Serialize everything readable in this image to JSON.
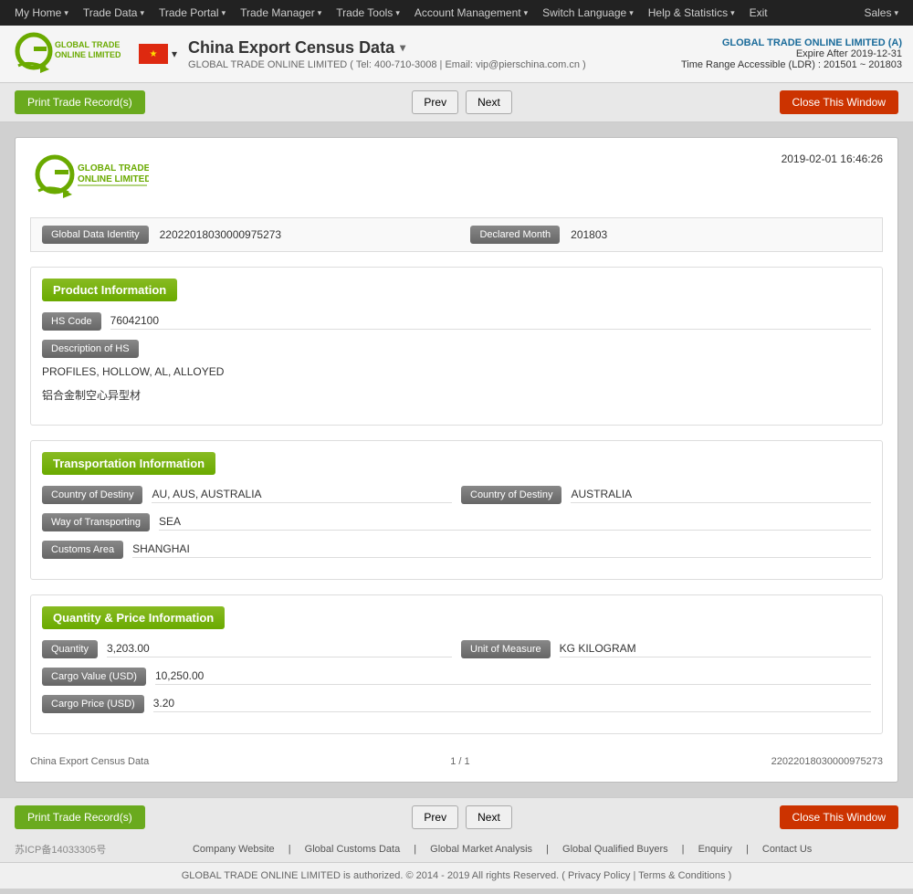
{
  "topNav": {
    "items": [
      {
        "label": "My Home",
        "hasArrow": true
      },
      {
        "label": "Trade Data",
        "hasArrow": true
      },
      {
        "label": "Trade Portal",
        "hasArrow": true
      },
      {
        "label": "Trade Manager",
        "hasArrow": true
      },
      {
        "label": "Trade Tools",
        "hasArrow": true
      },
      {
        "label": "Account Management",
        "hasArrow": true
      },
      {
        "label": "Switch Language",
        "hasArrow": true
      },
      {
        "label": "Help & Statistics",
        "hasArrow": true
      },
      {
        "label": "Exit",
        "hasArrow": false
      }
    ],
    "salesLabel": "Sales"
  },
  "header": {
    "title": "China Export Census Data",
    "subtitle": "GLOBAL TRADE ONLINE LIMITED ( Tel: 400-710-3008 | Email: vip@pierschina.com.cn )",
    "companyName": "GLOBAL TRADE ONLINE LIMITED (A)",
    "expire": "Expire After 2019-12-31",
    "ldr": "Time Range Accessible (LDR) : 201501 ~ 201803"
  },
  "actionBar": {
    "printLabel": "Print Trade Record(s)",
    "prevLabel": "Prev",
    "nextLabel": "Next",
    "closeLabel": "Close This Window"
  },
  "record": {
    "timestamp": "2019-02-01 16:46:26",
    "globalDataIdentityLabel": "Global Data Identity",
    "globalDataIdentityValue": "22022018030000975273",
    "declaredMonthLabel": "Declared Month",
    "declaredMonthValue": "201803",
    "productInfo": {
      "sectionLabel": "Product Information",
      "hsCodeLabel": "HS Code",
      "hsCodeValue": "76042100",
      "descriptionOfHSLabel": "Description of HS",
      "descriptionLine1": "PROFILES, HOLLOW, AL, ALLOYED",
      "descriptionLine2": "铝合金制空心异型材"
    },
    "transportInfo": {
      "sectionLabel": "Transportation Information",
      "countryOfDestinyLabel": "Country of Destiny",
      "countryOfDestinyValue": "AU, AUS, AUSTRALIA",
      "countryOfDestiny2Label": "Country of Destiny",
      "countryOfDestiny2Value": "AUSTRALIA",
      "wayOfTransportingLabel": "Way of Transporting",
      "wayOfTransportingValue": "SEA",
      "customsAreaLabel": "Customs Area",
      "customsAreaValue": "SHANGHAI"
    },
    "quantityInfo": {
      "sectionLabel": "Quantity & Price Information",
      "quantityLabel": "Quantity",
      "quantityValue": "3,203.00",
      "unitOfMeasureLabel": "Unit of Measure",
      "unitOfMeasureValue": "KG KILOGRAM",
      "cargoValueLabel": "Cargo Value (USD)",
      "cargoValueValue": "10,250.00",
      "cargoPriceLabel": "Cargo Price (USD)",
      "cargoPriceValue": "3.20"
    },
    "footer": {
      "dataSource": "China Export Census Data",
      "pagination": "1 / 1",
      "recordId": "22022018030000975273"
    }
  },
  "footer": {
    "icpText": "苏ICP备14033305号",
    "links": [
      {
        "label": "Company Website"
      },
      {
        "label": "Global Customs Data"
      },
      {
        "label": "Global Market Analysis"
      },
      {
        "label": "Global Qualified Buyers"
      },
      {
        "label": "Enquiry"
      },
      {
        "label": "Contact Us"
      }
    ],
    "copyright": "GLOBAL TRADE ONLINE LIMITED is authorized. © 2014 - 2019 All rights Reserved.  (  Privacy Policy  |  Terms & Conditions  )"
  }
}
